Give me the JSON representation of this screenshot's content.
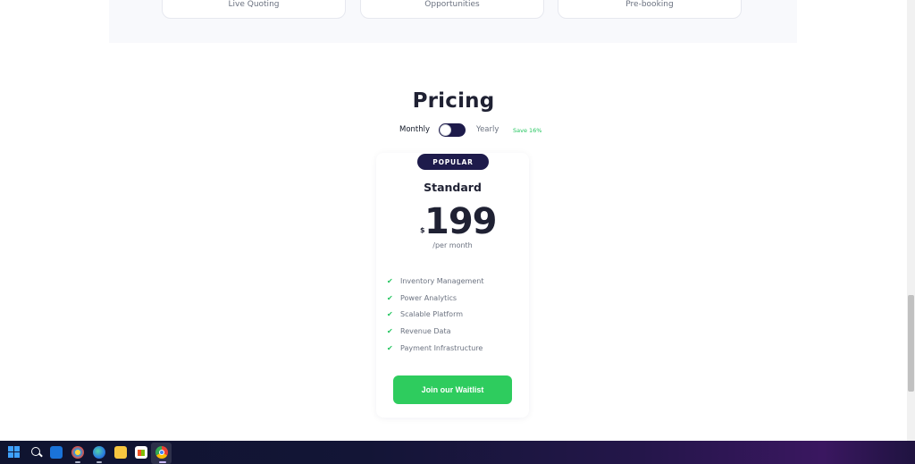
{
  "features_strip": {
    "cards": [
      {
        "label": "Live Quoting"
      },
      {
        "label": "Opportunities"
      },
      {
        "label": "Pre-booking"
      }
    ]
  },
  "pricing": {
    "title": "Pricing",
    "toggle": {
      "monthly_label": "Monthly",
      "yearly_label": "Yearly",
      "save_label": "Save 16%",
      "selected": "Monthly"
    },
    "plan": {
      "badge": "POPULAR",
      "name": "Standard",
      "currency": "$",
      "amount": "199",
      "period": "/per month",
      "features": [
        "Inventory Management",
        "Power Analytics",
        "Scalable Platform",
        "Revenue Data",
        "Payment Infrastructure"
      ],
      "cta": "Join our Waitlist"
    }
  },
  "taskbar": {
    "icons": [
      "windows-start-icon",
      "search-icon",
      "mail-icon",
      "photos-icon",
      "edge-icon",
      "file-explorer-icon",
      "store-icon",
      "chrome-icon"
    ]
  },
  "colors": {
    "brand_dark": "#1e1b4b",
    "accent_green": "#2ecc5e",
    "save_green": "#22c55e"
  }
}
